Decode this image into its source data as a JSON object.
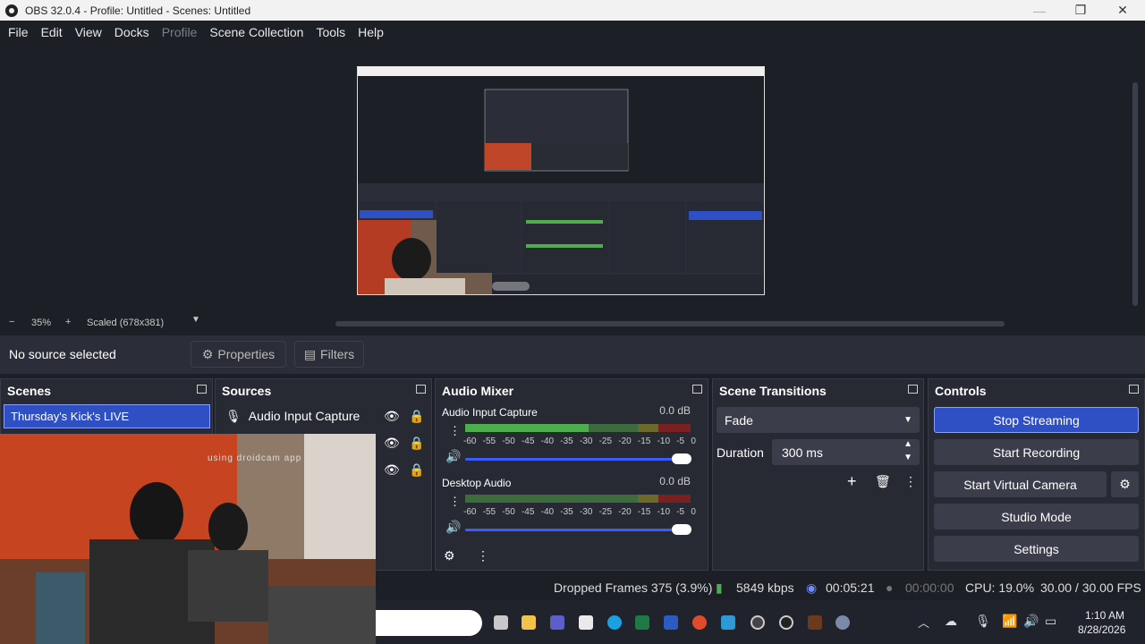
{
  "window": {
    "title": "OBS 32.0.4 - Profile: Untitled - Scenes: Untitled",
    "minimize": "—",
    "maximize": "❐",
    "close": "✕"
  },
  "menu": {
    "file": "File",
    "edit": "Edit",
    "view": "View",
    "docks": "Docks",
    "profile": "Profile",
    "scene_collection": "Scene Collection",
    "tools": "Tools",
    "help": "Help"
  },
  "zoom": {
    "minus": "−",
    "level": "35%",
    "plus": "+",
    "scale": "Scaled (678x381)"
  },
  "source_bar": {
    "selection": "No source selected",
    "properties": "Properties",
    "filters": "Filters"
  },
  "scenes": {
    "title": "Scenes",
    "items": [
      "Thursday's Kick's LIVE"
    ]
  },
  "sources": {
    "title": "Sources",
    "items": [
      "Audio Input Capture"
    ]
  },
  "mixer": {
    "title": "Audio Mixer",
    "channels": [
      {
        "name": "Audio Input Capture",
        "db": "0.0 dB"
      },
      {
        "name": "Desktop Audio",
        "db": "0.0 dB"
      }
    ],
    "scale": [
      "-60",
      "-55",
      "-50",
      "-45",
      "-40",
      "-35",
      "-30",
      "-25",
      "-20",
      "-15",
      "-10",
      "-5",
      "0"
    ]
  },
  "transitions": {
    "title": "Scene Transitions",
    "selected": "Fade",
    "duration_label": "Duration",
    "duration_value": "300 ms"
  },
  "controls": {
    "title": "Controls",
    "stop_streaming": "Stop Streaming",
    "start_recording": "Start Recording",
    "start_virtual_camera": "Start Virtual Camera",
    "studio_mode": "Studio Mode",
    "settings": "Settings"
  },
  "status": {
    "dropped": "Dropped Frames 375 (3.9%)",
    "bitrate": "5849 kbps",
    "stream_time": "00:05:21",
    "record_time": "00:00:00",
    "cpu": "CPU: 19.0%",
    "fps": "30.00 / 30.00 FPS"
  },
  "camera_overlay_text": "using droidcam app",
  "taskbar": {
    "time": "1:10 AM",
    "date": "8/28/2026"
  },
  "colors": {
    "accent": "#3b5cff",
    "selected": "#2f4fc4",
    "meter_green": "#4cae4c",
    "meter_yellow": "#c9b81b",
    "meter_red": "#c0392b"
  }
}
